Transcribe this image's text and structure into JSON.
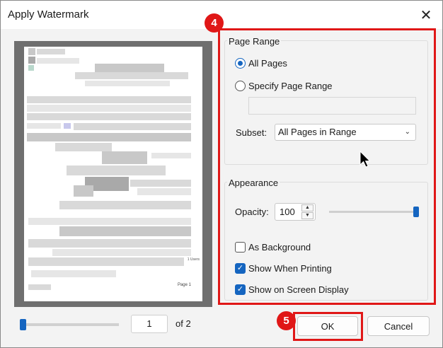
{
  "window": {
    "title": "Apply Watermark"
  },
  "icons": {
    "close": "✕",
    "chevron": "⌄",
    "up": "▲",
    "down": "▼",
    "check": "✓"
  },
  "preview": {
    "footer_text": "Page 1",
    "side_note": "1 Users",
    "current_page": "1",
    "page_count_text": "of 2",
    "page_slider_fraction": 0.0
  },
  "page_range": {
    "group_title": "Page Range",
    "options": [
      {
        "label": "All Pages",
        "selected": true
      },
      {
        "label": "Specify Page Range",
        "selected": false
      }
    ],
    "range_value": "",
    "subset_label": "Subset:",
    "subset_value": "All Pages in Range"
  },
  "appearance": {
    "group_title": "Appearance",
    "opacity_label": "Opacity:",
    "opacity_value": "100",
    "opacity_fraction": 1.0,
    "checkboxes": [
      {
        "label": "As Background",
        "checked": false
      },
      {
        "label": "Show When Printing",
        "checked": true
      },
      {
        "label": "Show on Screen Display",
        "checked": true
      }
    ]
  },
  "buttons": {
    "ok": "OK",
    "cancel": "Cancel"
  },
  "callouts": {
    "panel": "4",
    "ok": "5"
  },
  "colors": {
    "accent": "#1565c0",
    "callout": "#e01717"
  }
}
